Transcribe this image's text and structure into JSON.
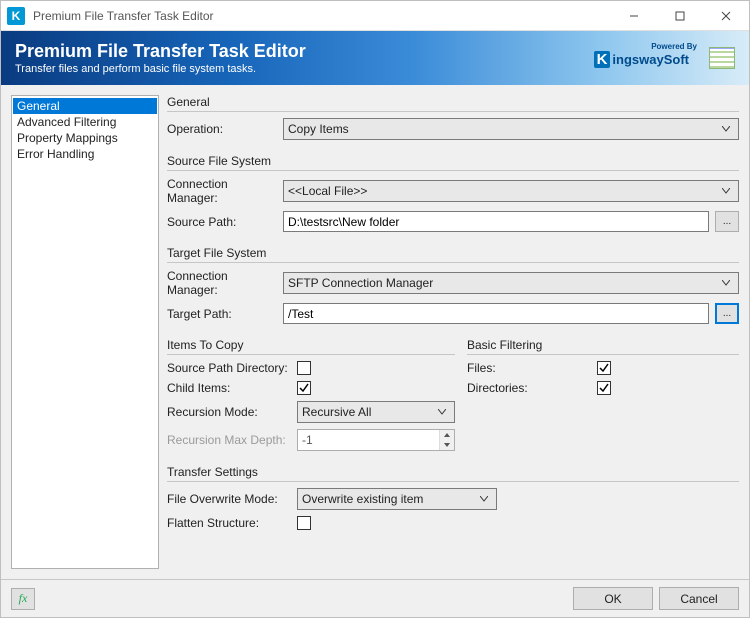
{
  "titlebar": {
    "title": "Premium File Transfer Task Editor"
  },
  "banner": {
    "title": "Premium File Transfer Task Editor",
    "subtitle": "Transfer files and perform basic file system tasks.",
    "powered_by": "Powered By",
    "brand_rest": "ingswaySoft"
  },
  "sidebar": {
    "items": [
      {
        "label": "General",
        "selected": true
      },
      {
        "label": "Advanced Filtering",
        "selected": false
      },
      {
        "label": "Property Mappings",
        "selected": false
      },
      {
        "label": "Error Handling",
        "selected": false
      }
    ]
  },
  "general": {
    "heading": "General",
    "operation_label": "Operation:",
    "operation_value": "Copy Items"
  },
  "source": {
    "heading": "Source File System",
    "conn_label": "Connection Manager:",
    "conn_value": "<<Local File>>",
    "path_label": "Source Path:",
    "path_value": "D:\\testsrc\\New folder",
    "browse": "..."
  },
  "target": {
    "heading": "Target File System",
    "conn_label": "Connection Manager:",
    "conn_value": "SFTP Connection Manager",
    "path_label": "Target Path:",
    "path_value": "/Test",
    "browse": "..."
  },
  "items_to_copy": {
    "heading": "Items To Copy",
    "source_path_dir_label": "Source Path Directory:",
    "source_path_dir_checked": false,
    "child_items_label": "Child Items:",
    "child_items_checked": true,
    "recursion_mode_label": "Recursion Mode:",
    "recursion_mode_value": "Recursive All",
    "recursion_depth_label": "Recursion Max Depth:",
    "recursion_depth_value": "-1"
  },
  "basic_filtering": {
    "heading": "Basic Filtering",
    "files_label": "Files:",
    "files_checked": true,
    "directories_label": "Directories:",
    "directories_checked": true
  },
  "transfer": {
    "heading": "Transfer Settings",
    "overwrite_label": "File Overwrite Mode:",
    "overwrite_value": "Overwrite existing item",
    "flatten_label": "Flatten Structure:",
    "flatten_checked": false
  },
  "footer": {
    "fx": "fx",
    "ok": "OK",
    "cancel": "Cancel"
  }
}
